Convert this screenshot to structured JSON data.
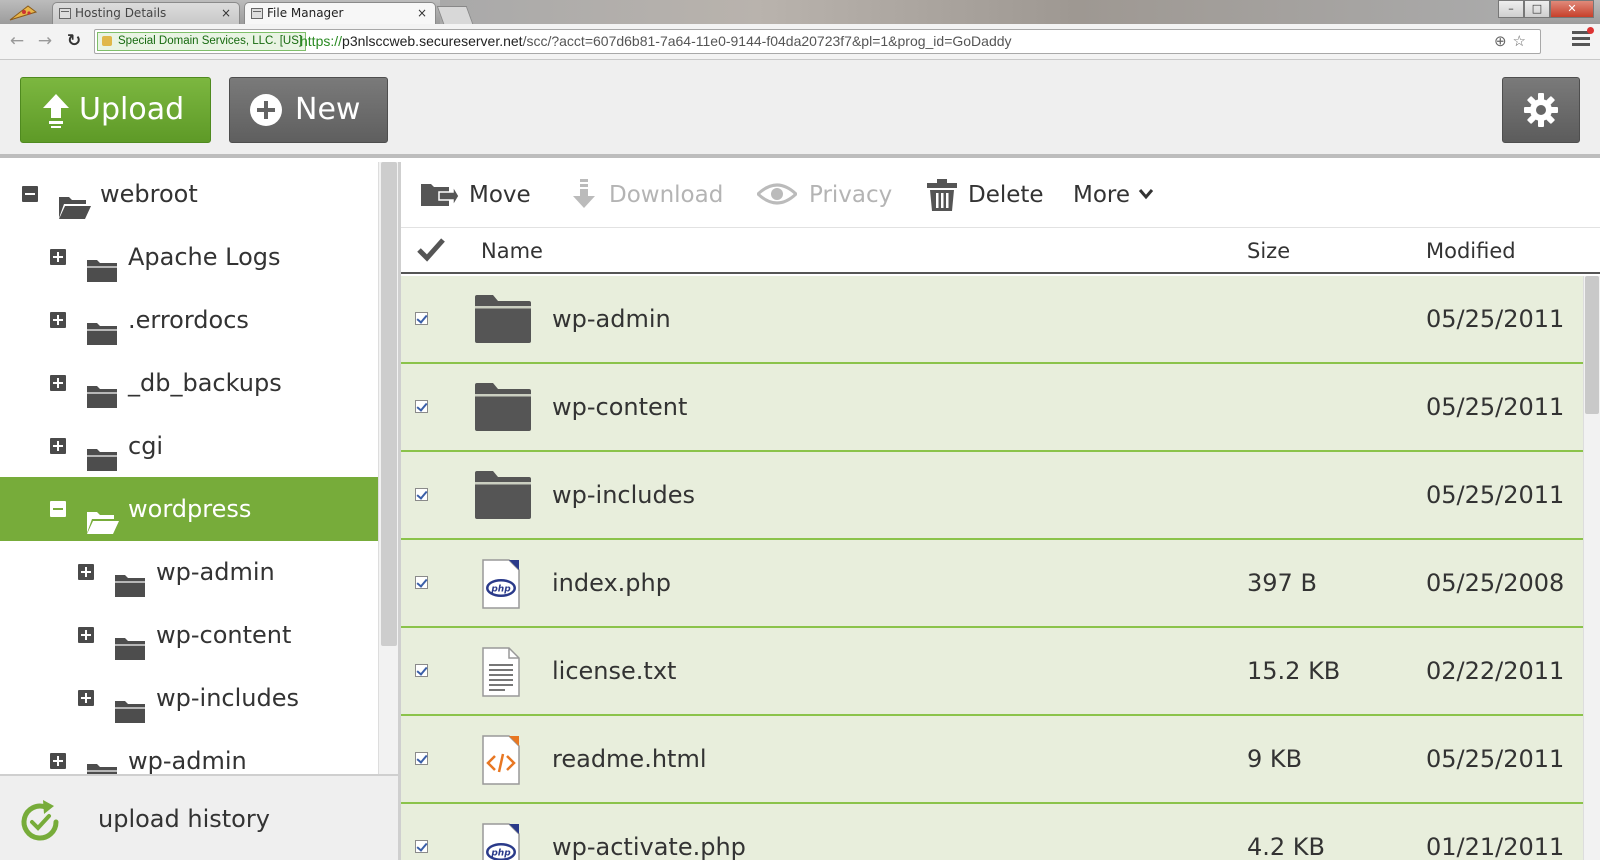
{
  "browser": {
    "tabs": [
      {
        "label": "Hosting Details",
        "close": "×"
      },
      {
        "label": "File Manager",
        "close": "×"
      }
    ],
    "ev_cert": "Special Domain Services, LLC. [US]",
    "url": {
      "scheme": "https://",
      "host": "p3nlsccweb.secureserver.net",
      "path": "/scc/?acct=607d6b81-7a64-11e0-9144-f04da20723f7&pl=1&prog_id=GoDaddy"
    }
  },
  "header": {
    "upload_label": "Upload",
    "new_label": "New"
  },
  "tree": {
    "items": [
      {
        "label": "webroot",
        "expander": "minus",
        "depth": 0,
        "selected": false
      },
      {
        "label": "Apache Logs",
        "expander": "plus",
        "depth": 1,
        "selected": false
      },
      {
        "label": ".errordocs",
        "expander": "plus",
        "depth": 1,
        "selected": false
      },
      {
        "label": "_db_backups",
        "expander": "plus",
        "depth": 1,
        "selected": false
      },
      {
        "label": "cgi",
        "expander": "plus",
        "depth": 1,
        "selected": false
      },
      {
        "label": "wordpress",
        "expander": "minus",
        "depth": 1,
        "selected": true
      },
      {
        "label": "wp-admin",
        "expander": "plus",
        "depth": 2,
        "selected": false
      },
      {
        "label": "wp-content",
        "expander": "plus",
        "depth": 2,
        "selected": false
      },
      {
        "label": "wp-includes",
        "expander": "plus",
        "depth": 2,
        "selected": false
      },
      {
        "label": "wp-admin",
        "expander": "plus",
        "depth": 1,
        "selected": false
      }
    ],
    "history_label": "upload history"
  },
  "actions": {
    "move": "Move",
    "download": "Download",
    "privacy": "Privacy",
    "delete": "Delete",
    "more": "More"
  },
  "columns": {
    "name": "Name",
    "size": "Size",
    "modified": "Modified"
  },
  "files": [
    {
      "name": "wp-admin",
      "size": "",
      "modified": "05/25/2011",
      "icon": "folder-icon",
      "checked": true
    },
    {
      "name": "wp-content",
      "size": "",
      "modified": "05/25/2011",
      "icon": "folder-icon",
      "checked": true
    },
    {
      "name": "wp-includes",
      "size": "",
      "modified": "05/25/2011",
      "icon": "folder-icon",
      "checked": true
    },
    {
      "name": "index.php",
      "size": "397 B",
      "modified": "05/25/2008",
      "icon": "php-file-icon",
      "checked": true
    },
    {
      "name": "license.txt",
      "size": "15.2 KB",
      "modified": "02/22/2011",
      "icon": "text-file-icon",
      "checked": true
    },
    {
      "name": "readme.html",
      "size": "9 KB",
      "modified": "05/25/2011",
      "icon": "html-file-icon",
      "checked": true
    },
    {
      "name": "wp-activate.php",
      "size": "4.2 KB",
      "modified": "01/21/2011",
      "icon": "php-file-icon",
      "checked": true
    }
  ],
  "colors": {
    "accent_green": "#77ac3a",
    "row_bg": "#e8eedc",
    "row_border": "#8bc34a",
    "button_gray": "#636363"
  }
}
